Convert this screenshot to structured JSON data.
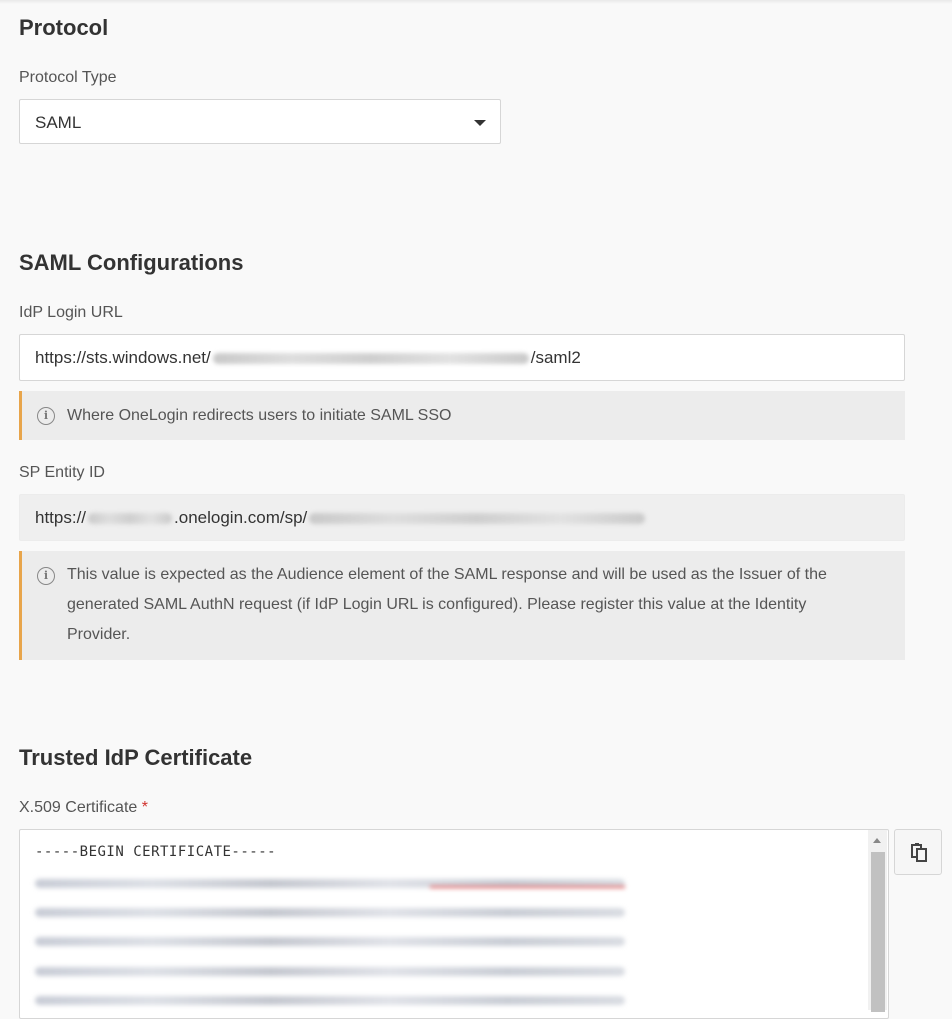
{
  "protocol": {
    "heading": "Protocol",
    "type_label": "Protocol Type",
    "type_value": "SAML"
  },
  "saml": {
    "heading": "SAML Configurations",
    "idp_login_url": {
      "label": "IdP Login URL",
      "prefix": "https://sts.windows.net/",
      "suffix": "/saml2",
      "hint": "Where OneLogin redirects users to initiate SAML SSO"
    },
    "sp_entity_id": {
      "label": "SP Entity ID",
      "prefix": "https://",
      "middle": ".onelogin.com/sp/",
      "hint": "This value is expected as the Audience element of the SAML response and will be used as the Issuer of the generated SAML AuthN request (if IdP Login URL is configured). Please register this value at the Identity Provider."
    }
  },
  "certificate": {
    "heading": "Trusted IdP Certificate",
    "label": "X.509 Certificate",
    "required_mark": "*",
    "begin_line": "-----BEGIN CERTIFICATE-----"
  },
  "icons": {
    "info": "info-icon",
    "dropdown": "chevron-down-icon",
    "copy": "copy-icon"
  },
  "colors": {
    "note_accent": "#e8a54b",
    "required": "#d0312d"
  }
}
